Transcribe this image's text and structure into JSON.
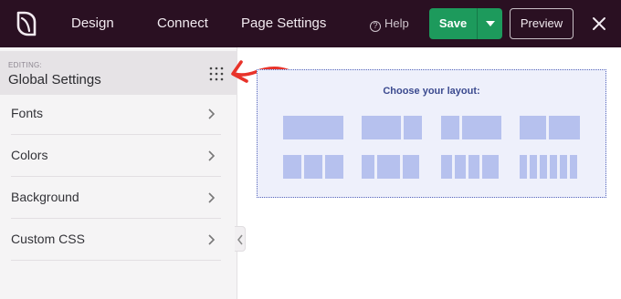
{
  "topbar": {
    "nav": [
      "Design",
      "Connect",
      "Page Settings"
    ],
    "help_label": "Help",
    "save_label": "Save",
    "preview_label": "Preview",
    "colors": {
      "background": "#2a1022",
      "save": "#1d9a5c"
    },
    "icons": [
      "seedprod-logo-icon",
      "help-circle-icon",
      "caret-down-icon",
      "close-icon"
    ]
  },
  "sidebar": {
    "editing_label": "EDITING:",
    "title": "Global Settings",
    "items": [
      {
        "label": "Fonts"
      },
      {
        "label": "Colors"
      },
      {
        "label": "Background"
      },
      {
        "label": "Custom CSS"
      }
    ],
    "icons": [
      "grip-dots-icon",
      "chevron-right-icon",
      "chevron-left-icon"
    ]
  },
  "annotation": {
    "color": "#e8332a",
    "icon": "red-arrow-icon"
  },
  "canvas": {
    "layout_prompt": "Choose your layout:",
    "layouts": [
      {
        "name": "1 column"
      },
      {
        "name": "2 columns"
      },
      {
        "name": "1/3 + 2/3"
      },
      {
        "name": "2/3 + 1/3"
      },
      {
        "name": "3 columns"
      },
      {
        "name": "1/4 + 1/4 + 1/2"
      },
      {
        "name": "1/4 + 1/2 + 1/4"
      },
      {
        "name": "6 columns"
      }
    ],
    "colors": {
      "background": "#eef0fb",
      "block": "#b6c1ee",
      "title": "#3b4a8f"
    }
  }
}
